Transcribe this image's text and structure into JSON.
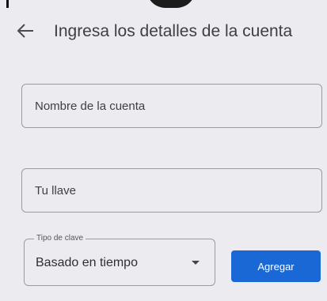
{
  "header": {
    "back_icon": "arrow-left-icon",
    "title": "Ingresa los detalles de la cuenta"
  },
  "form": {
    "account_name": {
      "placeholder": "Nombre de la cuenta",
      "value": ""
    },
    "key": {
      "placeholder": "Tu llave",
      "value": ""
    },
    "key_type": {
      "label": "Tipo de clave",
      "selected": "Basado en tiempo",
      "icon": "caret-down-icon"
    },
    "add_label": "Agregar"
  },
  "colors": {
    "background": "#ecebf0",
    "accent": "#1a67d6"
  }
}
